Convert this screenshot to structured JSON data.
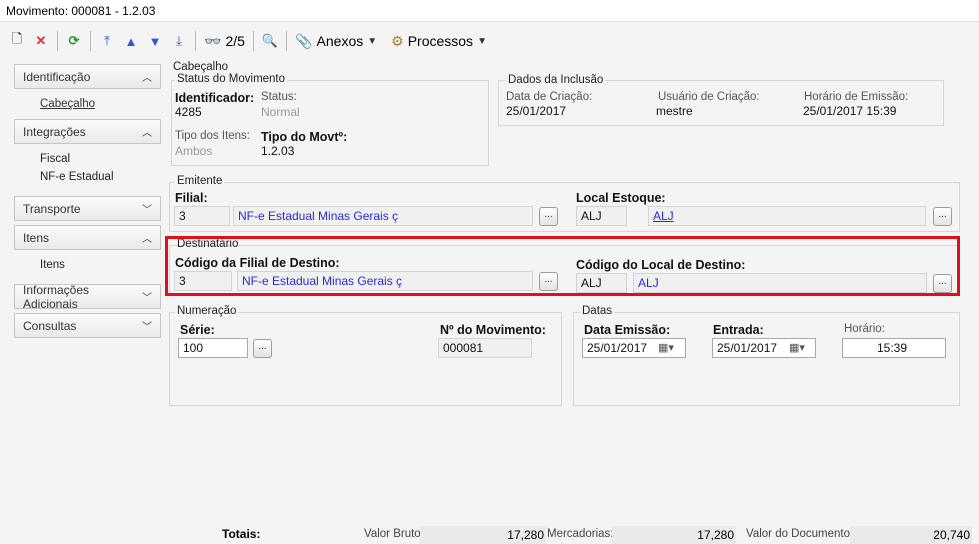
{
  "window": {
    "title": "Movimento: 000081 - 1.2.03"
  },
  "toolbar": {
    "page_indicator": "2/5",
    "anexos": "Anexos",
    "processos": "Processos"
  },
  "sidebar": {
    "identificacao": "Identificação",
    "cabecalho": "Cabeçalho",
    "integracoes": "Integrações",
    "fiscal": "Fiscal",
    "nfe_estadual": "NF-e Estadual",
    "transporte": "Transporte",
    "itens": "Itens",
    "itens_sub": "Itens",
    "informacoes_adicionais": "Informações Adicionais",
    "consultas": "Consultas"
  },
  "cabecalho": {
    "label": "Cabeçalho"
  },
  "status_movimento": {
    "title": "Status do Movimento",
    "identificador_label": "Identificador:",
    "identificador_value": "4285",
    "status_label": "Status:",
    "status_value": "Normal",
    "tipo_itens_label": "Tipo dos Itens:",
    "tipo_itens_value": "Ambos",
    "tipo_movto_label": "Tipo do Movtº:",
    "tipo_movto_value": "1.2.03"
  },
  "dados_inclusao": {
    "title": "Dados da Inclusão",
    "data_criacao_label": "Data de Criação:",
    "data_criacao_value": "25/01/2017",
    "usuario_label": "Usuário de Criação:",
    "usuario_value": "mestre",
    "horario_label": "Horário de Emissão:",
    "horario_value": "25/01/2017 15:39"
  },
  "emitente": {
    "title": "Emitente",
    "filial_label": "Filial:",
    "filial_code": "3",
    "filial_name": "NF-e Estadual Minas Gerais ç",
    "local_label": "Local Estoque:",
    "local_code": "ALJ",
    "local_name": "ALJ"
  },
  "destinatario": {
    "title": "Destinatário",
    "filial_label": "Código da Filial de Destino:",
    "filial_code": "3",
    "filial_name": "NF-e Estadual Minas Gerais ç",
    "local_label": "Código do Local de Destino:",
    "local_code": "ALJ",
    "local_name": "ALJ"
  },
  "numeracao": {
    "title": "Numeração",
    "serie_label": "Série:",
    "serie_value": "100",
    "numero_label": "Nº do Movimento:",
    "numero_value": "000081"
  },
  "datas": {
    "title": "Datas",
    "emissao_label": "Data Emissão:",
    "emissao_value": "25/01/2017",
    "entrada_label": "Entrada:",
    "entrada_value": "25/01/2017",
    "horario_label": "Horário:",
    "horario_value": "15:39"
  },
  "totals": {
    "label": "Totais:",
    "valor_bruto_label": "Valor Bruto:",
    "valor_bruto_value": "17,280",
    "mercadorias_label": "Mercadorias:",
    "mercadorias_value": "17,280",
    "valor_doc_label": "Valor do Documento:",
    "valor_doc_value": "20,740"
  },
  "colors": {
    "highlight": "#e0101a",
    "link": "#2a2ad0"
  }
}
